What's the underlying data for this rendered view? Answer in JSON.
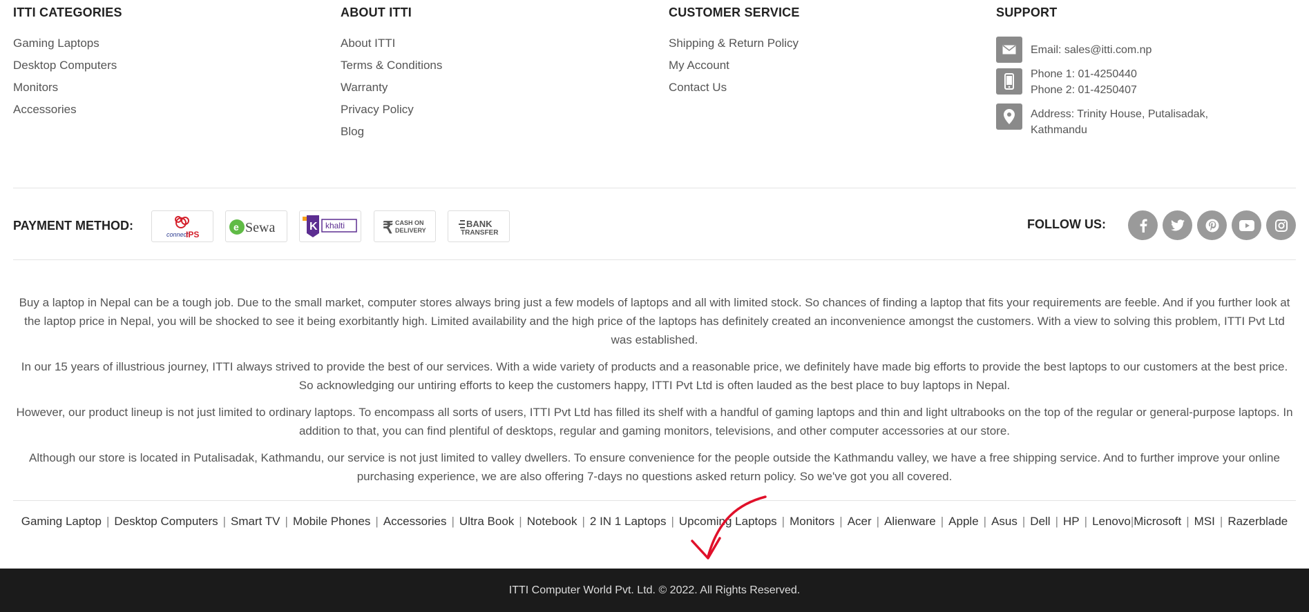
{
  "categories": {
    "heading": "ITTI CATEGORIES",
    "items": [
      "Gaming Laptops",
      "Desktop Computers",
      "Monitors",
      "Accessories"
    ]
  },
  "about_itti": {
    "heading": "ABOUT ITTI",
    "items": [
      "About ITTI",
      "Terms & Conditions",
      "Warranty",
      "Privacy Policy",
      "Blog"
    ]
  },
  "customer_service": {
    "heading": "CUSTOMER SERVICE",
    "items": [
      "Shipping & Return Policy",
      "My Account",
      "Contact Us"
    ]
  },
  "support": {
    "heading": "SUPPORT",
    "email": "Email: sales@itti.com.np",
    "phone1": "Phone 1: 01-4250440",
    "phone2": "Phone 2: 01-4250407",
    "address_line1": "Address: Trinity House, Putalisadak,",
    "address_line2": "Kathmandu",
    "icons": [
      "email-icon",
      "phone-icon",
      "location-icon"
    ]
  },
  "payment": {
    "label": "PAYMENT METHOD:",
    "logos": {
      "ips": {
        "name": "connectIPS",
        "line1": "connect",
        "line2": "IPS"
      },
      "esewa": {
        "name": "eSewa",
        "text": "Sewa"
      },
      "khalti": {
        "name": "Khalti",
        "text": "khalti"
      },
      "cod": {
        "name": "Cash on Delivery",
        "line1": "CASH ON",
        "line2": "DELIVERY"
      },
      "bank": {
        "name": "Bank Transfer",
        "line1": "BANK",
        "line2": "TRANSFER"
      }
    }
  },
  "follow": {
    "label": "FOLLOW US:",
    "networks": [
      "facebook",
      "twitter",
      "pinterest",
      "youtube",
      "instagram"
    ]
  },
  "about_text": {
    "p1": "Buy a laptop in Nepal can be a tough job. Due to the small market, computer stores always bring just a few models of laptops and all with limited stock. So chances of finding a laptop that fits your requirements are feeble.  And if you further look at the laptop price in Nepal, you will be shocked to see it being exorbitantly high. Limited availability and the high price of the laptops has definitely created an inconvenience amongst the customers. With a view to solving this problem, ITTI Pvt Ltd was established.",
    "p2": "In our 15 years of illustrious journey, ITTI always strived to provide the best of our services. With a wide variety of products and a reasonable price, we definitely have made big efforts to provide the best laptops to our customers at the best price. So acknowledging our untiring efforts to keep the customers happy, ITTI Pvt Ltd is often lauded as the best place to buy laptops in Nepal.",
    "p3": "However, our product lineup is not just limited to ordinary laptops. To encompass all sorts of users, ITTI Pvt Ltd has filled its shelf with a handful of gaming laptops and thin and light ultrabooks on the top of the regular or general-purpose laptops. In addition to that, you can find plentiful of desktops, regular and gaming monitors, televisions, and other computer accessories at our store.",
    "p4": "Although our store is located in Putalisadak, Kathmandu, our service is not just limited to valley dwellers. To ensure convenience for the people outside the Kathmandu valley, we have a free shipping service. And to further improve your online purchasing experience, we are also offering 7-days no questions asked return policy. So we've got you all covered."
  },
  "quick_links": {
    "items": [
      "Gaming Laptop",
      "Desktop Computers",
      "Smart TV",
      "Mobile Phones",
      "Accessories",
      "Ultra Book",
      "Notebook",
      "2 IN 1 Laptops",
      "Upcoming Laptops",
      "Monitors",
      "Acer",
      "Alienware",
      "Apple",
      "Asus",
      "Dell",
      "HP",
      "Lenovo",
      "Microsoft",
      "MSI",
      "Razerblade"
    ],
    "separator": "|"
  },
  "footer": {
    "copyright": "ITTI Computer World Pvt. Ltd. © 2022. All Rights Reserved."
  },
  "colors": {
    "footer_bg": "#1b1b1b",
    "icon_gray": "#9a9a9a",
    "annotation_red": "#e0102a"
  }
}
